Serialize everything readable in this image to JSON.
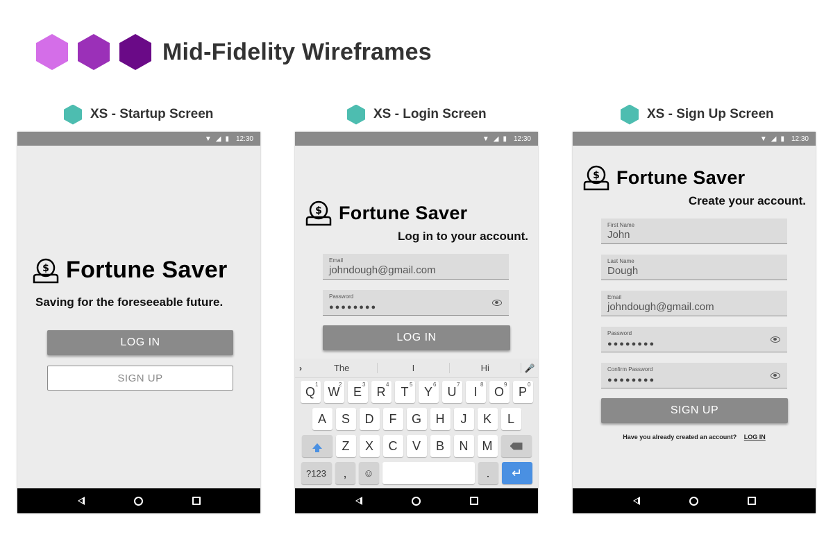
{
  "page": {
    "title": "Mid-Fidelity Wireframes"
  },
  "colors": {
    "hex1": "#d46ee8",
    "hex2": "#9b30b8",
    "hex3": "#6a0a87",
    "teal": "#4dbdb0",
    "gray_button": "#8a8a8a",
    "screen_bg": "#ececec",
    "field_bg": "#dcdcdc",
    "keyboard_blue": "#4a90e2"
  },
  "status_bar": {
    "time": "12:30",
    "icons": [
      "wifi-icon",
      "signal-icon",
      "battery-icon"
    ]
  },
  "nav_bar": {
    "icons": [
      "back-icon",
      "home-icon",
      "recent-apps-icon"
    ]
  },
  "brand": "Fortune Saver",
  "screens": {
    "startup": {
      "label": "XS - Startup Screen",
      "tagline": "Saving for the foreseeable future.",
      "login_button": "LOG IN",
      "signup_button": "SIGN UP"
    },
    "login": {
      "label": "XS - Login Screen",
      "subtitle": "Log in to your account.",
      "email_label": "Email",
      "email_value": "johndough@gmail.com",
      "password_label": "Password",
      "password_value": "●●●●●●●●",
      "login_button": "LOG IN",
      "keyboard": {
        "suggestions": [
          "The",
          "I",
          "Hi"
        ],
        "row1": [
          "Q",
          "W",
          "E",
          "R",
          "T",
          "Y",
          "U",
          "I",
          "O",
          "P"
        ],
        "row1_numbers": [
          "1",
          "2",
          "3",
          "4",
          "5",
          "6",
          "7",
          "8",
          "9",
          "0"
        ],
        "row2": [
          "A",
          "S",
          "D",
          "F",
          "G",
          "H",
          "J",
          "K",
          "L"
        ],
        "row3": [
          "Z",
          "X",
          "C",
          "V",
          "B",
          "N",
          "M"
        ],
        "symbols_key": "?123",
        "comma_key": ",",
        "period_key": "."
      }
    },
    "signup": {
      "label": "XS - Sign Up Screen",
      "subtitle": "Create your account.",
      "first_name_label": "First Name",
      "first_name_value": "John",
      "last_name_label": "Last Name",
      "last_name_value": "Dough",
      "email_label": "Email",
      "email_value": "johndough@gmail.com",
      "password_label": "Password",
      "password_value": "●●●●●●●●",
      "confirm_label": "Confirm Password",
      "confirm_value": "●●●●●●●●",
      "signup_button": "SIGN UP",
      "already_text": "Have you already created an account?",
      "login_link": "LOG IN"
    }
  }
}
